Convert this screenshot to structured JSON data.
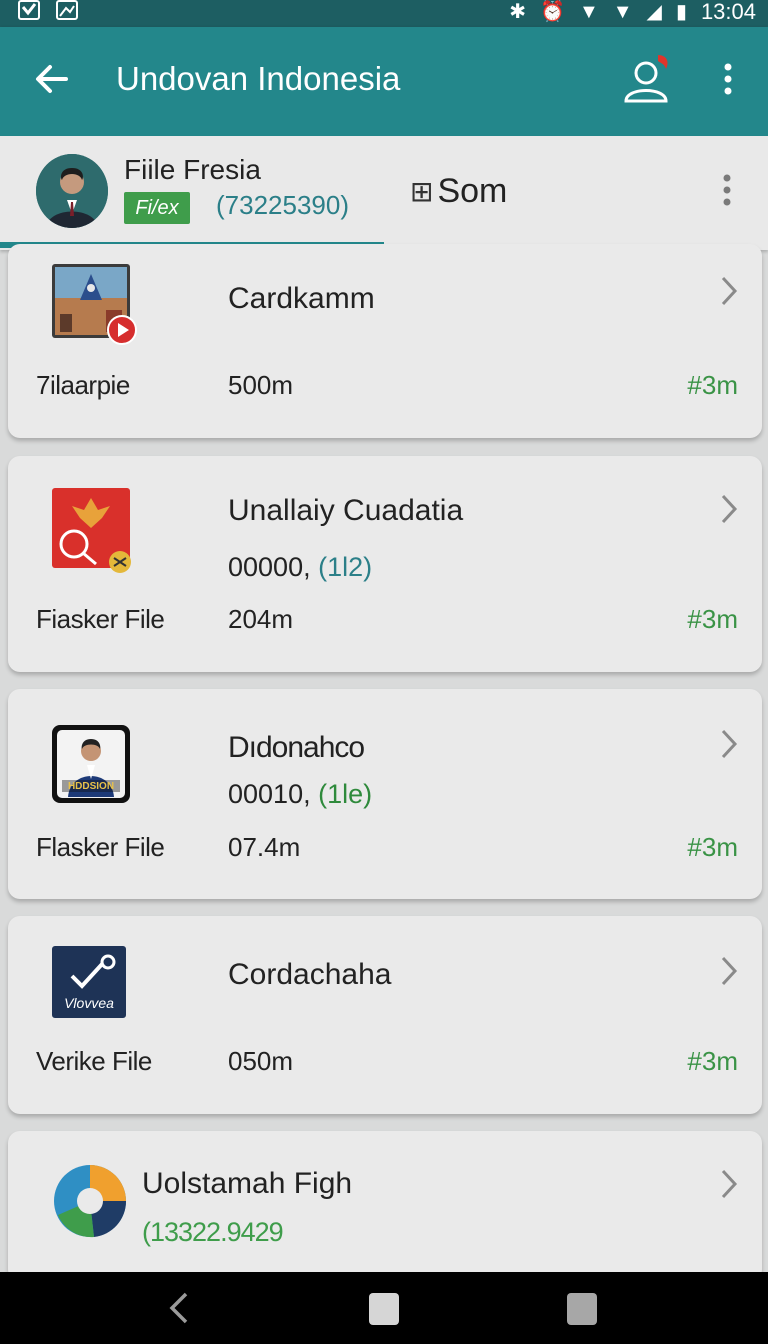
{
  "status_bar": {
    "time": "13:04",
    "left_icons": [
      "check-box-icon",
      "image-icon"
    ],
    "right_icons": [
      "bluetooth-off-icon",
      "alarm-icon",
      "wifi-icon",
      "signal-icon",
      "signal-icon",
      "battery-icon"
    ]
  },
  "app_bar": {
    "title": "Undovan Indonesia",
    "back_icon": "arrow-left-icon",
    "user_icon": "user-alert-icon",
    "more_icon": "more-vert-icon"
  },
  "profile": {
    "name": "Fiile Fresia",
    "badge": "Fi/ex",
    "phone": "(73225390)",
    "som_label": "Som"
  },
  "cards": [
    {
      "title": "Cardkamm",
      "left_label": "7ilaarpie",
      "size": "500m",
      "tag": "#3m"
    },
    {
      "title": "Unallaiy Cuadatia",
      "num": "00000,",
      "num_paren": "(1l2)",
      "left_label": "Fiasker File",
      "size": "204m",
      "tag": "#3m"
    },
    {
      "title": "Dıdonahco",
      "num": "00010,",
      "num_paren": "(1le)",
      "thumb_text": "HDDSION",
      "left_label": "Flasker File",
      "size": "07.4m",
      "tag": "#3m"
    },
    {
      "title": "Cordachaha",
      "thumb_text": "Vlovvea",
      "left_label": "Verike File",
      "size": "050m",
      "tag": "#3m"
    },
    {
      "title": "Uolstamah Figh",
      "num_paren": "(13322.9429"
    }
  ],
  "colors": {
    "status_bar": "#1d5e62",
    "app_bar": "#23878b",
    "accent_green": "#3a9346",
    "phone_teal": "#2b7f88"
  }
}
